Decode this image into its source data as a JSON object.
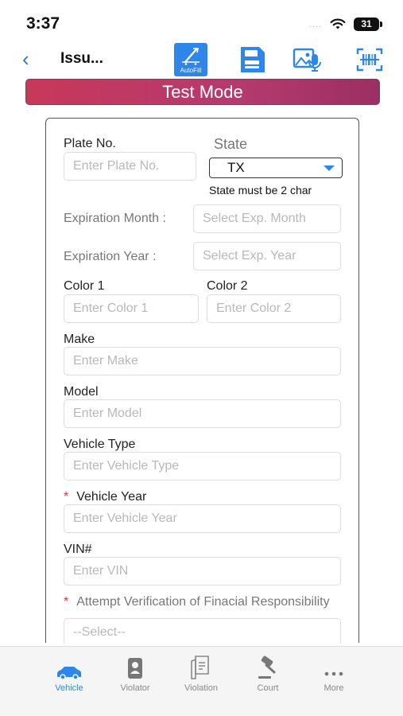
{
  "status_bar": {
    "time": "3:37",
    "signal": "....",
    "battery": "31"
  },
  "nav": {
    "back": "‹",
    "title": "Issu...",
    "autofill_label": "AutoFill",
    "icons": [
      "autofill-icon",
      "save-icon",
      "photo-voice-icon",
      "barcode-scan-icon"
    ]
  },
  "banner": "Test Mode",
  "form": {
    "plate": {
      "label": "Plate No.",
      "placeholder": "Enter Plate No."
    },
    "state": {
      "label": "State",
      "value": "TX",
      "hint": "State must be 2 char"
    },
    "exp_month": {
      "label": "Expiration Month :",
      "placeholder": "Select Exp. Month"
    },
    "exp_year": {
      "label": "Expiration Year :",
      "placeholder": "Select Exp. Year"
    },
    "color1": {
      "label": "Color 1",
      "placeholder": "Enter Color 1"
    },
    "color2": {
      "label": "Color 2",
      "placeholder": "Enter Color 2"
    },
    "make": {
      "label": "Make",
      "placeholder": "Enter Make"
    },
    "model": {
      "label": "Model",
      "placeholder": "Enter Model"
    },
    "vehicle_type": {
      "label": "Vehicle Type",
      "placeholder": "Enter Vehicle Type"
    },
    "vehicle_year": {
      "required": "*",
      "label": "Vehicle Year",
      "placeholder": "Enter Vehicle Year"
    },
    "vin": {
      "label": "VIN#",
      "placeholder": "Enter VIN"
    },
    "financial": {
      "required": "*",
      "label": "Attempt Verification of Finacial Responsibility",
      "placeholder": "--Select--"
    }
  },
  "tabs": [
    {
      "label": "Vehicle",
      "icon": "car-icon",
      "active": true
    },
    {
      "label": "Violator",
      "icon": "id-card-icon",
      "active": false
    },
    {
      "label": "Violation",
      "icon": "ticket-icon",
      "active": false
    },
    {
      "label": "Court",
      "icon": "gavel-icon",
      "active": false
    },
    {
      "label": "More",
      "icon": "more-icon",
      "active": false
    }
  ],
  "colors": {
    "accent": "#2e86e8",
    "banner": "#c8385a",
    "required": "#e23434"
  }
}
